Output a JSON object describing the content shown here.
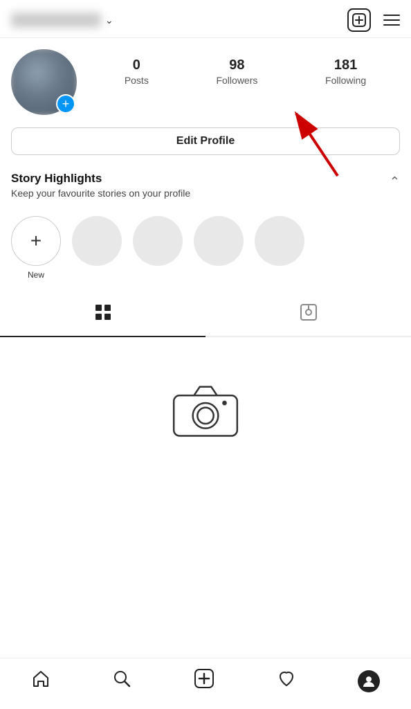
{
  "header": {
    "username_placeholder": "username",
    "add_icon_label": "+",
    "menu_icon_label": "menu"
  },
  "profile": {
    "posts_count": "0",
    "posts_label": "Posts",
    "followers_count": "98",
    "followers_label": "Followers",
    "following_count": "181",
    "following_label": "Following",
    "add_story_icon": "+"
  },
  "edit_profile": {
    "button_label": "Edit Profile"
  },
  "highlights": {
    "title": "Story Highlights",
    "subtitle": "Keep your favourite stories on your profile",
    "chevron": "^",
    "new_label": "New",
    "items": [
      {
        "label": ""
      },
      {
        "label": ""
      },
      {
        "label": ""
      },
      {
        "label": ""
      }
    ]
  },
  "tabs": {
    "grid_tab_label": "Grid",
    "tag_tab_label": "Tagged"
  },
  "bottom_nav": {
    "home_label": "Home",
    "search_label": "Search",
    "add_label": "Add",
    "heart_label": "Activity",
    "profile_label": "Profile"
  }
}
